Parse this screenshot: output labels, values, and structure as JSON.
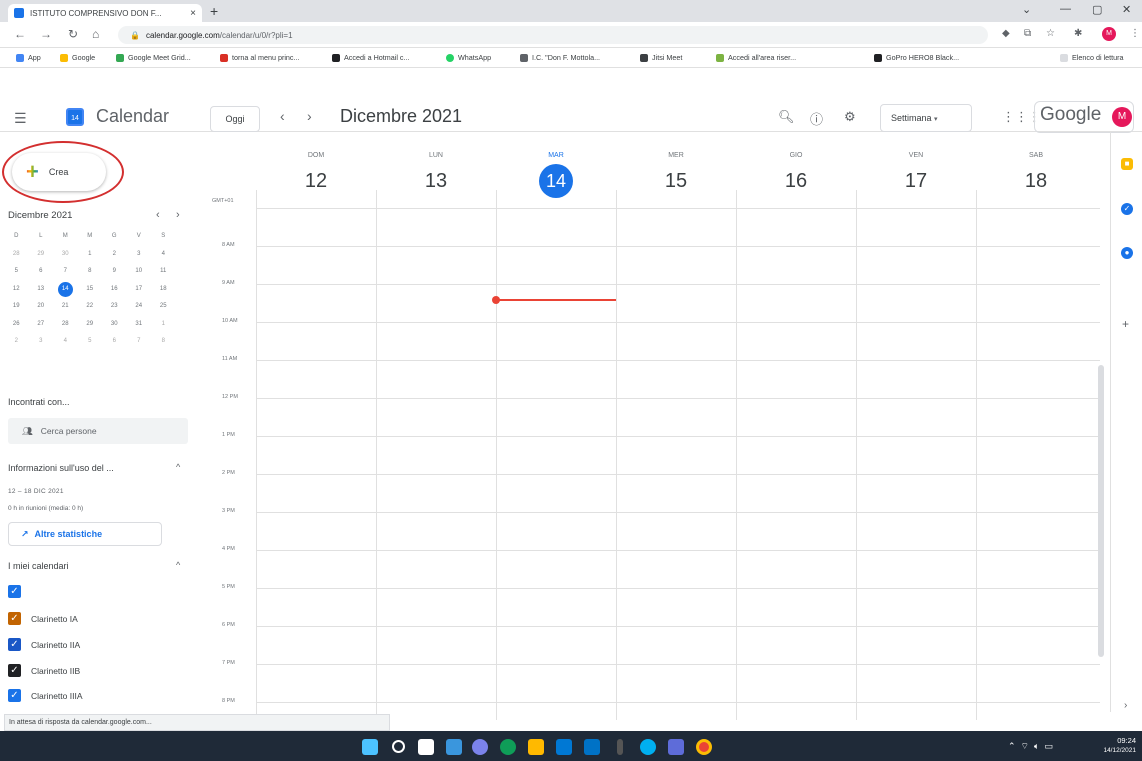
{
  "browser": {
    "tab_title": "ISTITUTO COMPRENSIVO DON F...",
    "url_host": "calendar.google.com",
    "url_path": "/calendar/u/0/r?pli=1",
    "status_text": "In attesa di risposta da calendar.google.com...",
    "bookmarks": [
      "App",
      "Google",
      "Google Meet Grid...",
      "torna al menu princ...",
      "Accedi a Hotmail c...",
      "WhatsApp",
      "I.C. \"Don F. Mottola...",
      "Jitsi Meet",
      "Accedi all'area riser...",
      "GoPro HERO8 Black...",
      "Elenco di lettura"
    ]
  },
  "header": {
    "app_name": "Calendar",
    "logo_day": "14",
    "today_label": "Oggi",
    "month_title": "Dicembre 2021",
    "view_label": "Settimana",
    "google_label": "Google",
    "avatar_letter": "M"
  },
  "create": {
    "label": "Crea"
  },
  "mini": {
    "title": "Dicembre 2021",
    "weekdays": [
      "D",
      "L",
      "M",
      "M",
      "G",
      "V",
      "S"
    ],
    "weeks": [
      [
        "28",
        "29",
        "30",
        "1",
        "2",
        "3",
        "4"
      ],
      [
        "5",
        "6",
        "7",
        "8",
        "9",
        "10",
        "11"
      ],
      [
        "12",
        "13",
        "14",
        "15",
        "16",
        "17",
        "18"
      ],
      [
        "19",
        "20",
        "21",
        "22",
        "23",
        "24",
        "25"
      ],
      [
        "26",
        "27",
        "28",
        "29",
        "30",
        "31",
        "1"
      ],
      [
        "2",
        "3",
        "4",
        "5",
        "6",
        "7",
        "8"
      ]
    ]
  },
  "sidebar": {
    "meet_title": "Incontrati con...",
    "search_people": "Cerca persone",
    "usage_title": "Informazioni sull'uso del ...",
    "usage_range": "12 – 18 DIC 2021",
    "usage_hours": "0 h in riunioni (media: 0 h)",
    "stats_label": "Altre statistiche",
    "mycal_title": "I miei calendari",
    "calendars": [
      {
        "name": "",
        "color": "#1a73e8"
      },
      {
        "name": "Clarinetto IA",
        "color": "#c26401"
      },
      {
        "name": "Clarinetto IIA",
        "color": "#1a57c6"
      },
      {
        "name": "Clarinetto IIB",
        "color": "#202124"
      },
      {
        "name": "Clarinetto IIIA",
        "color": "#1a73e8"
      }
    ]
  },
  "week": {
    "gmt": "GMT+01",
    "days": [
      {
        "dow": "DOM",
        "num": "12"
      },
      {
        "dow": "LUN",
        "num": "13"
      },
      {
        "dow": "MAR",
        "num": "14"
      },
      {
        "dow": "MER",
        "num": "15"
      },
      {
        "dow": "GIO",
        "num": "16"
      },
      {
        "dow": "VEN",
        "num": "17"
      },
      {
        "dow": "SAB",
        "num": "18"
      }
    ],
    "hours": [
      "8 AM",
      "9 AM",
      "10 AM",
      "11 AM",
      "12 PM",
      "1 PM",
      "2 PM",
      "3 PM",
      "4 PM",
      "5 PM",
      "6 PM",
      "7 PM",
      "8 PM"
    ]
  },
  "taskbar": {
    "time": "09:24",
    "date": "14/12/2021"
  },
  "colors": {
    "accent": "#1a73e8",
    "now_line": "#ea4335",
    "annotation_circle": "#d32f2f"
  }
}
